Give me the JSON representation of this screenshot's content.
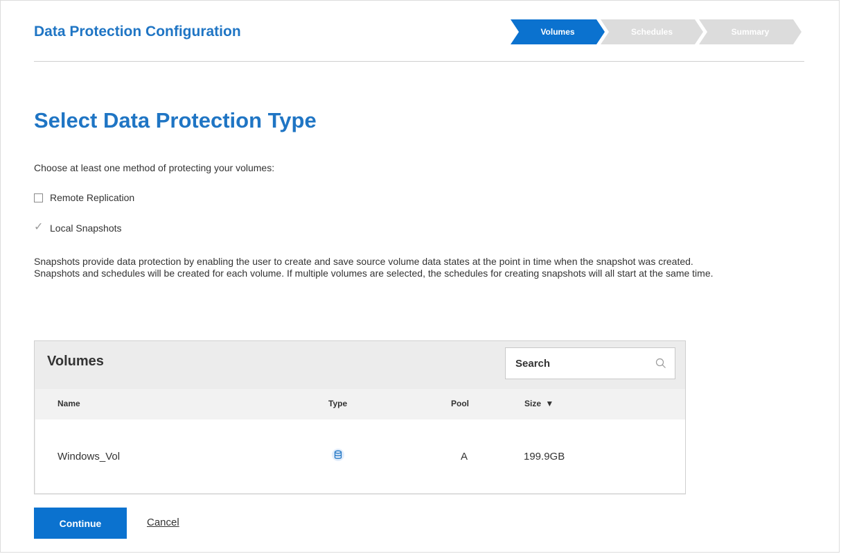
{
  "header": {
    "title": "Data Protection Configuration",
    "steps": [
      {
        "label": "Volumes",
        "state": "active"
      },
      {
        "label": "Schedules",
        "state": "inactive"
      },
      {
        "label": "Summary",
        "state": "inactive"
      }
    ]
  },
  "main": {
    "title": "Select Data Protection Type",
    "instructions": "Choose at least one method of protecting your volumes:",
    "options": [
      {
        "label": "Remote Replication",
        "checked": false
      },
      {
        "label": "Local Snapshots",
        "checked": true
      }
    ],
    "description_lines": [
      "Snapshots provide data protection by enabling the user to create and save source volume data states at the point in time when the snapshot was created.",
      "Snapshots and schedules will be created for each volume. If multiple volumes are selected, the schedules for creating snapshots will all start at the same time."
    ]
  },
  "volumes_panel": {
    "title": "Volumes",
    "search_placeholder": "Search",
    "columns": [
      "Name",
      "Type",
      "Pool",
      "Size"
    ],
    "sort_indicator": "▼",
    "rows": [
      {
        "name": "Windows_Vol",
        "type_icon": "volume-icon",
        "pool": "A",
        "size": "199.9GB"
      }
    ]
  },
  "actions": {
    "continue_label": "Continue",
    "cancel_label": "Cancel"
  },
  "colors": {
    "accent": "#1f75c4",
    "button": "#0b72cf",
    "step_inactive": "#dcdcdc"
  }
}
